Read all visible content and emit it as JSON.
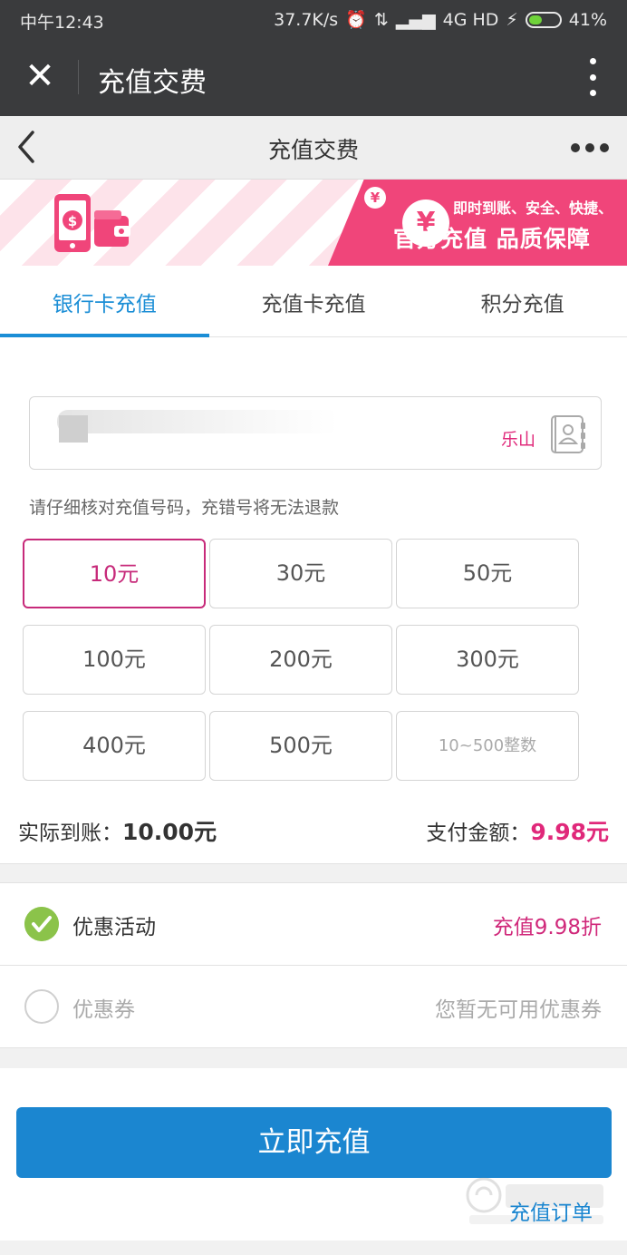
{
  "status_bar": {
    "time": "中午12:43",
    "speed": "37.7K/s",
    "network": "4G HD",
    "battery": "41%"
  },
  "wechat_bar": {
    "title": "充值交费"
  },
  "page_header": {
    "title": "充值交费"
  },
  "banner": {
    "tagline": "即时到账、安全、快捷、",
    "headline": "官方充值 品质保障",
    "yen_symbol": "¥",
    "coin_symbol": "¥"
  },
  "tabs": [
    {
      "label": "银行卡充值",
      "active": true
    },
    {
      "label": "充值卡充值",
      "active": false
    },
    {
      "label": "积分充值",
      "active": false
    }
  ],
  "phone": {
    "region": "乐山"
  },
  "notice": "请仔细核对充值号码，充错号将无法退款",
  "amounts": [
    {
      "label": "10元",
      "selected": true
    },
    {
      "label": "30元",
      "selected": false
    },
    {
      "label": "50元",
      "selected": false
    },
    {
      "label": "100元",
      "selected": false
    },
    {
      "label": "200元",
      "selected": false
    },
    {
      "label": "300元",
      "selected": false
    },
    {
      "label": "400元",
      "selected": false
    },
    {
      "label": "500元",
      "selected": false
    },
    {
      "label": "10~500整数",
      "selected": false
    }
  ],
  "totals": {
    "received_label": "实际到账：",
    "received_value": "10.00元",
    "pay_label": "支付金额：",
    "pay_value": "9.98元"
  },
  "promotion": {
    "label": "优惠活动",
    "value": "充值9.98折",
    "checked": true
  },
  "coupon": {
    "label": "优惠券",
    "value": "您暂无可用优惠券",
    "checked": false
  },
  "pay_button": "立即充值",
  "orders_link": "充值订单",
  "colors": {
    "accent_blue": "#1b86d0",
    "accent_pink": "#e0287a",
    "check_green": "#8bc34a"
  }
}
